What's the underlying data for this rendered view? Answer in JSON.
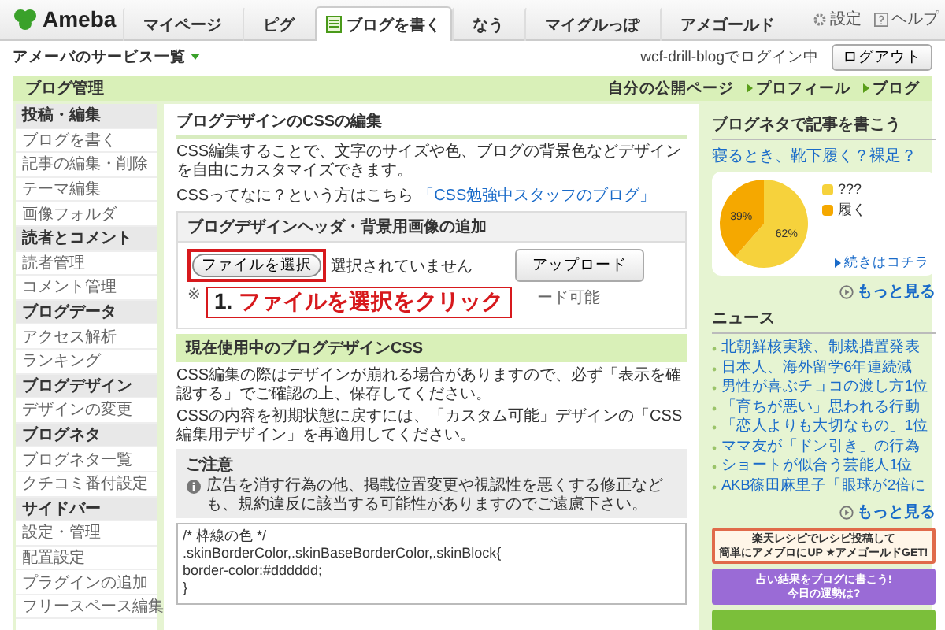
{
  "brand": {
    "name": "Ameba"
  },
  "nav_tabs": [
    {
      "label": "マイページ",
      "selected": false,
      "kind": "plain"
    },
    {
      "label": "ピグ",
      "selected": false,
      "kind": "plain"
    },
    {
      "label": "ブログを書く",
      "selected": true,
      "kind": "icon"
    },
    {
      "label": "なう",
      "selected": false,
      "kind": "plain"
    },
    {
      "label": "マイグルっぽ",
      "selected": false,
      "kind": "plain"
    },
    {
      "label": "アメゴールド",
      "selected": false,
      "kind": "plain"
    }
  ],
  "nav_tools": [
    {
      "label": "設定",
      "kind": "settings"
    },
    {
      "label": "ヘルプ",
      "kind": "help"
    }
  ],
  "sub_bar": {
    "services": "アメーバのサービス一覧",
    "login_status": "wcf-drill-blogでログイン中",
    "logout": "ログアウト"
  },
  "header": {
    "title": "ブログ管理",
    "my_page": "自分の公開ページ",
    "links": [
      "プロフィール",
      "ブログ"
    ]
  },
  "sidebar": {
    "items": [
      {
        "label": "投稿・編集",
        "kind": "heading"
      },
      {
        "label": "ブログを書く",
        "kind": "link"
      },
      {
        "label": "記事の編集・削除",
        "kind": "link"
      },
      {
        "label": "テーマ編集",
        "kind": "link"
      },
      {
        "label": "画像フォルダ",
        "kind": "link"
      },
      {
        "label": "読者とコメント",
        "kind": "heading"
      },
      {
        "label": "読者管理",
        "kind": "link"
      },
      {
        "label": "コメント管理",
        "kind": "link"
      },
      {
        "label": "ブログデータ",
        "kind": "heading"
      },
      {
        "label": "アクセス解析",
        "kind": "link"
      },
      {
        "label": "ランキング",
        "kind": "link"
      },
      {
        "label": "ブログデザイン",
        "kind": "heading"
      },
      {
        "label": "デザインの変更",
        "kind": "link"
      },
      {
        "label": "ブログネタ",
        "kind": "heading"
      },
      {
        "label": "ブログネタ一覧",
        "kind": "link"
      },
      {
        "label": "クチコミ番付設定",
        "kind": "link"
      },
      {
        "label": "サイドバー",
        "kind": "heading"
      },
      {
        "label": "設定・管理",
        "kind": "link"
      },
      {
        "label": "配置設定",
        "kind": "link"
      },
      {
        "label": "プラグインの追加",
        "kind": "link"
      },
      {
        "label": "フリースペース編集",
        "kind": "link"
      }
    ]
  },
  "main": {
    "title": "ブログデザインのCSSの編集",
    "intro": "CSS編集することで、文字のサイズや色、ブログの背景色などデザインを自由にカスタマイズできます。",
    "intro_question": "CSSってなに？という方はこちら",
    "intro_link": "「CSS勉強中スタッフのブログ」",
    "upload": {
      "title": "ブログデザインヘッダ・背景用画像の追加",
      "file_button": "ファイルを選択",
      "file_status": "選択されていません",
      "upload_button": "アップロード",
      "note_start": "※",
      "note_end": "ード可能"
    },
    "callout": {
      "number": "1.",
      "text": "ファイルを選択をクリック"
    },
    "css_section": {
      "title": "現在使用中のブログデザインCSS",
      "paragraphs": [
        "CSS編集の際はデザインが崩れる場合がありますので、必ず「表示を確認する」でご確認の上、保存してください。",
        "CSSの内容を初期状態に戻すには、「カスタム可能」デザインの「CSS編集用デザイン」を再適用してください。"
      ],
      "caution_title": "ご注意",
      "caution_text": "広告を消す行為の他、掲載位置変更や視認性を悪くする修正なども、規約違反に該当する可能性がありますのでご遠慮下さい。",
      "css_lines": [
        "/* 枠線の色 */",
        ".skinBorderColor,.skinBaseBorderColor,.skinBlock{",
        "border-color:#dddddd;",
        "}"
      ]
    }
  },
  "right": {
    "neta_title": "ブログネタで記事を書こう",
    "question": "寝るとき、靴下履く？裸足？",
    "poll": {
      "slices": [
        {
          "color": "#f6d23c"
        },
        {
          "color": "#f5a800"
        }
      ],
      "chart_data": {
        "type": "pie",
        "categories": [
          "???",
          "履く"
        ],
        "values": [
          62,
          39
        ],
        "value_labels": [
          "62%",
          "39%"
        ]
      },
      "more_link": "続きはコチラ"
    },
    "more_1": "もっと見る",
    "news_title": "ニュース",
    "news": [
      "北朝鮮核実験、制裁措置発表",
      "日本人、海外留学6年連続減",
      "男性が喜ぶチョコの渡し方1位",
      "「育ちが悪い」思われる行動",
      "「恋人よりも大切なもの」1位",
      "ママ友が「ドン引き」の行為",
      "ショートが似合う芸能人1位",
      "AKB篠田麻里子「眼球が2倍に」"
    ],
    "more_2": "もっと見る",
    "banners": [
      {
        "kind": "recipe",
        "lines": [
          "楽天レシピでレシピ投稿して",
          "簡単にアメブロにUP ★アメゴールドGET!"
        ]
      },
      {
        "kind": "fortune",
        "lines": [
          "占い結果をブログに書こう!",
          "今日の運勢は?"
        ]
      },
      {
        "kind": "plain"
      }
    ]
  }
}
